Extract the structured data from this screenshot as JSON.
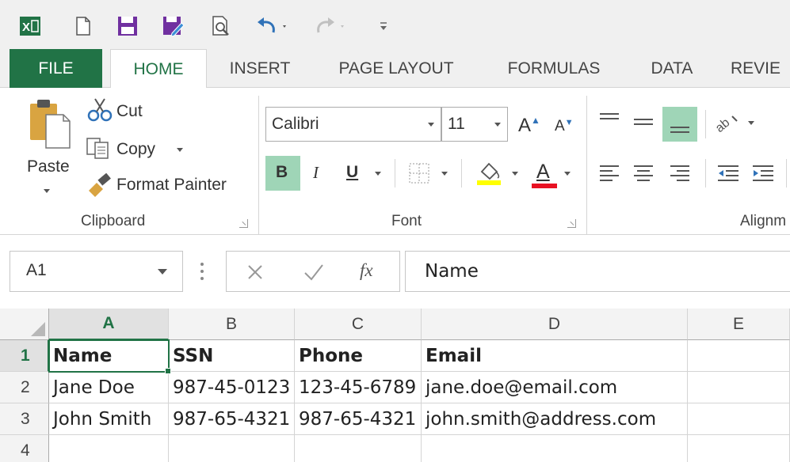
{
  "qat": {
    "icons": [
      "excel-logo-icon",
      "new-file-icon",
      "save-icon",
      "save-as-icon",
      "print-preview-icon",
      "undo-icon",
      "redo-icon",
      "customize-qat-icon"
    ]
  },
  "tabs": [
    "FILE",
    "HOME",
    "INSERT",
    "PAGE LAYOUT",
    "FORMULAS",
    "DATA",
    "REVIE"
  ],
  "clipboard": {
    "paste_label": "Paste",
    "cut_label": "Cut",
    "copy_label": "Copy",
    "format_painter_label": "Format Painter",
    "group_label": "Clipboard"
  },
  "font": {
    "font_name": "Calibri",
    "font_size": "11",
    "grow_label": "A",
    "shrink_label": "A",
    "bold_label": "B",
    "italic_label": "I",
    "underline_label": "U",
    "font_color_label": "A",
    "group_label": "Font",
    "highlight_color": "#ffff00",
    "font_color": "#e81123"
  },
  "alignment": {
    "group_label": "Alignm"
  },
  "formula_bar": {
    "name_box": "A1",
    "fx_label": "fx",
    "content": "Name"
  },
  "columns": [
    "A",
    "B",
    "C",
    "D",
    "E"
  ],
  "rows": [
    "1",
    "2",
    "3",
    "4"
  ],
  "cells": [
    [
      "Name",
      "SSN",
      "Phone",
      "Email",
      ""
    ],
    [
      "Jane Doe",
      "987-45-0123",
      "123-45-6789",
      "jane.doe@email.com",
      ""
    ],
    [
      "John Smith",
      "987-65-4321",
      "987-65-4321",
      "john.smith@address.com",
      ""
    ],
    [
      "",
      "",
      "",
      "",
      ""
    ]
  ],
  "colors": {
    "accent": "#217346",
    "selected_header": "#e1e1e1"
  }
}
